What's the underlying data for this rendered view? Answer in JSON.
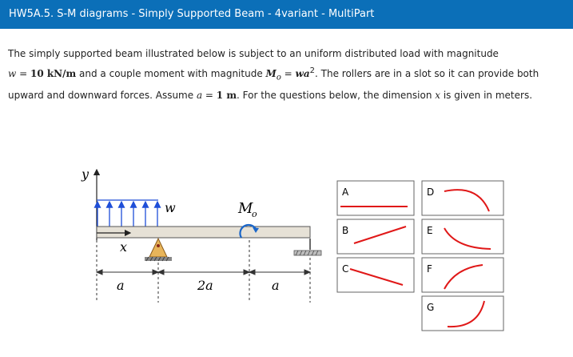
{
  "header": {
    "title": "HW5A.5. S-M diagrams - Simply Supported Beam - 4variant - MultiPart"
  },
  "prompt": {
    "p1": "The simply supported beam illustrated below is subject to an uniform distributed load with magnitude",
    "w_sym": "w",
    "eq1": " = ",
    "w_val": "10 kN/m",
    "p2": " and a couple moment with magnitude ",
    "mo_sym": "M",
    "mo_sub": "o",
    "eq2": " = ",
    "wa": "wa",
    "wa_sup": "2",
    "p3": ". The rollers are in a slot so it can provide both upward and downward forces. Assume ",
    "a_sym": "a",
    "eq3": " = ",
    "a_val": "1 m",
    "p4": ". For the questions below, the dimension ",
    "x_sym": "x",
    "p5": " is given in meters."
  },
  "diagram": {
    "y_label": "y",
    "x_label": "x",
    "load_label": "w",
    "moment_label": "M",
    "moment_sub": "o",
    "dim_labels": [
      "a",
      "2a",
      "a"
    ]
  },
  "options": {
    "labels": [
      "A",
      "B",
      "C",
      "D",
      "E",
      "F",
      "G"
    ],
    "curve_color": "#e01818"
  },
  "colors": {
    "header_bg": "#0b6fb8",
    "beam_fill": "#e6e1d6",
    "pin_fill": "#e8b55a",
    "load_color": "#1e4ed8"
  }
}
